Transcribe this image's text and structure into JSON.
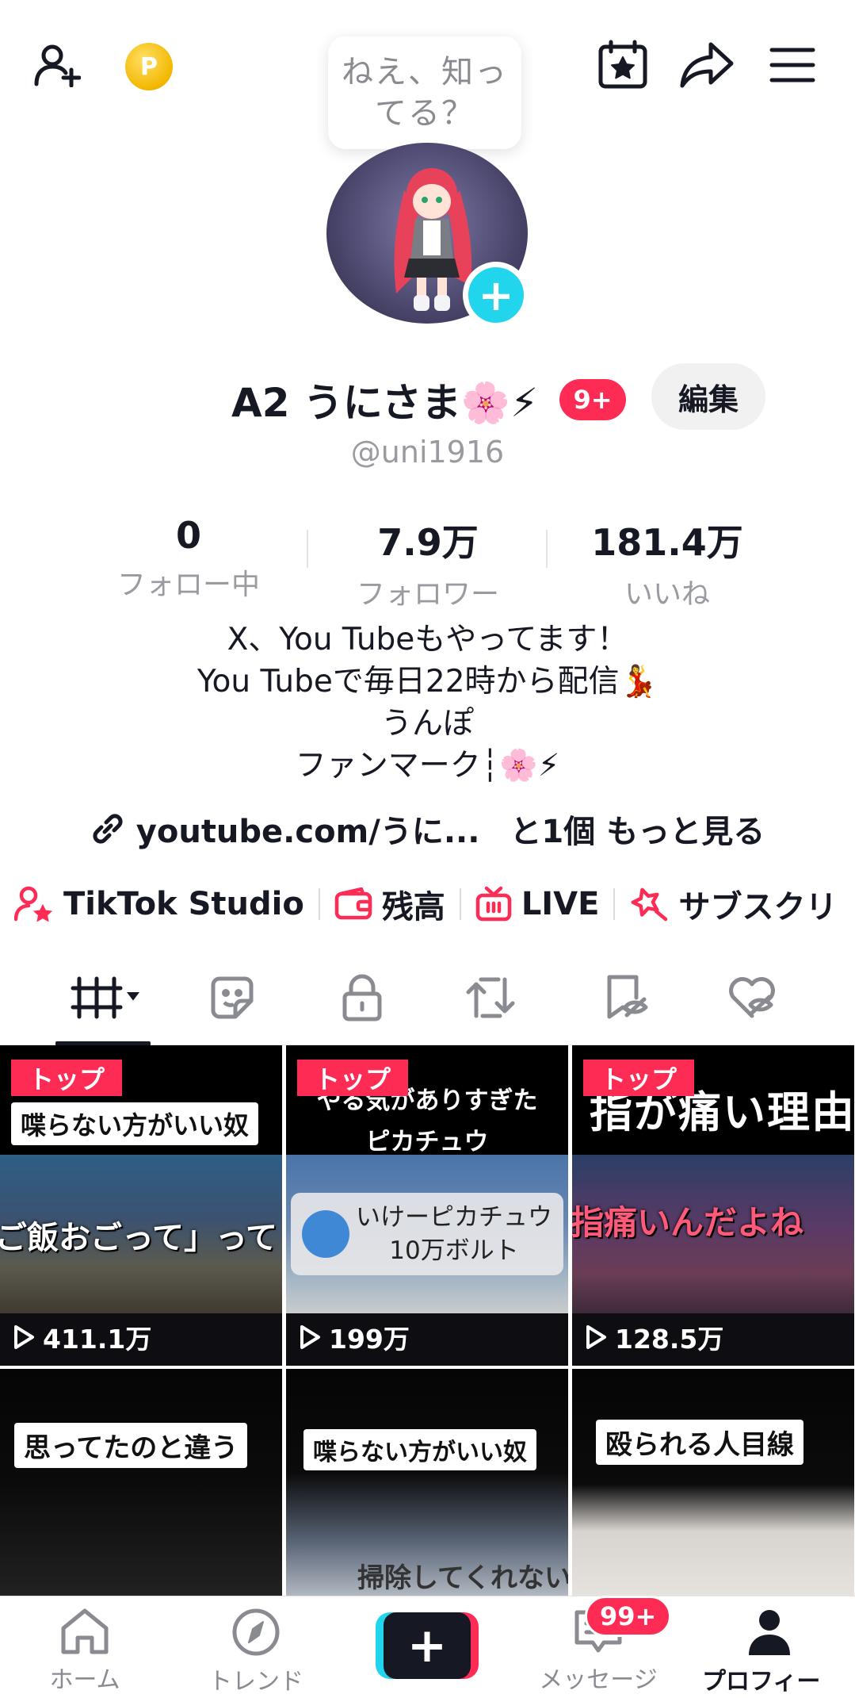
{
  "top_bar": {
    "add_friend_icon": "person-plus-icon",
    "coin_label": "P",
    "bubble_text": "ねえ、知ってる？",
    "calendar_icon": "calendar-star-icon",
    "share_icon": "share-arrow-icon",
    "menu_icon": "hamburger-menu-icon"
  },
  "profile": {
    "display_name": "A2 うにさま🌸⚡",
    "notification_badge": "9+",
    "edit_button": "編集",
    "handle": "@uni1916"
  },
  "stats": [
    {
      "value": "0",
      "label": "フォロー中"
    },
    {
      "value": "7.9万",
      "label": "フォロワー"
    },
    {
      "value": "181.4万",
      "label": "いいね"
    }
  ],
  "bio": {
    "lines": [
      "X、You Tubeもやってます！",
      "You Tubeで毎日22時から配信💃",
      "うんぽ",
      "ファンマーク┆🌸⚡"
    ],
    "link_text": "youtube.com/うに...",
    "more_text": "と1個 もっと見る"
  },
  "tools": [
    {
      "label": "TikTok Studio",
      "icon": "person-star-icon"
    },
    {
      "label": "残高",
      "icon": "wallet-icon"
    },
    {
      "label": "LIVE",
      "icon": "tv-icon"
    },
    {
      "label": "サブスクリ",
      "icon": "star-badge-icon"
    }
  ],
  "tabs": [
    "grid-videos-tab",
    "stickers-tab",
    "private-tab",
    "reposts-tab",
    "favorites-tab",
    "liked-tab"
  ],
  "videos": [
    {
      "badge": "トップ",
      "caption": "喋らない方がいい奴",
      "overlay": "ご飯おごって」って",
      "views": "411.1万"
    },
    {
      "badge": "トップ",
      "caption": "やる気がありすぎた\nピカチュウ",
      "overlay": "いけーピカチュウ\n10万ボルト",
      "views": "199万"
    },
    {
      "badge": "トップ",
      "caption": "指が痛い理由",
      "overlay": "指痛いんだよね",
      "views": "128.5万"
    },
    {
      "badge": "",
      "caption": "思ってたのと違う",
      "overlay": "",
      "views": ""
    },
    {
      "badge": "",
      "caption": "喋らない方がいい奴",
      "overlay": "掃除してくれない",
      "views": ""
    },
    {
      "badge": "",
      "caption": "殴られる人目線",
      "overlay": "",
      "views": ""
    }
  ],
  "nav": {
    "home": "ホーム",
    "trend": "トレンド",
    "messages": "メッセージ",
    "messages_badge": "99+",
    "profile": "プロフィール"
  },
  "colors": {
    "accent_red": "#fe2c55",
    "accent_cyan": "#20d5ec",
    "text": "#161823",
    "muted": "#9a9ba0"
  }
}
